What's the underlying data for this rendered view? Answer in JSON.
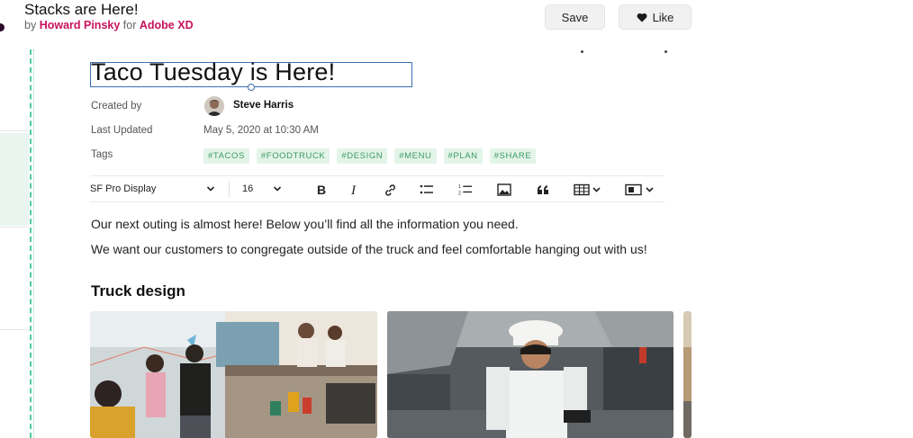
{
  "header": {
    "title": "Stacks are Here!",
    "by_prefix": "by",
    "author": "Howard Pinsky",
    "for_word": "for",
    "product": "Adobe XD",
    "save_label": "Save",
    "like_label": "Like"
  },
  "doc": {
    "title": "Taco Tuesday is Here!",
    "meta": {
      "created_by_label": "Created by",
      "created_by_value": "Steve Harris",
      "last_updated_label": "Last Updated",
      "last_updated_value": "May 5, 2020 at 10:30 AM",
      "tags_label": "Tags"
    },
    "tags": [
      "#TACOS",
      "#FOODTRUCK",
      "#DESIGN",
      "#MENU",
      "#PLAN",
      "#SHARE"
    ],
    "toolbar": {
      "font": "SF Pro Display",
      "size": "16"
    },
    "paragraphs": [
      "Our next outing is almost here! Below you’ll find all the information you need.",
      "We want our customers to congregate outside of the truck and feel comfortable hanging out with us!"
    ],
    "heading": "Truck design"
  },
  "colors": {
    "accent": "#c8125c",
    "tag_bg": "#e3f4e9",
    "tag_text": "#3c9a62",
    "selection": "#3a6fb0",
    "guide": "#4ecca0"
  }
}
